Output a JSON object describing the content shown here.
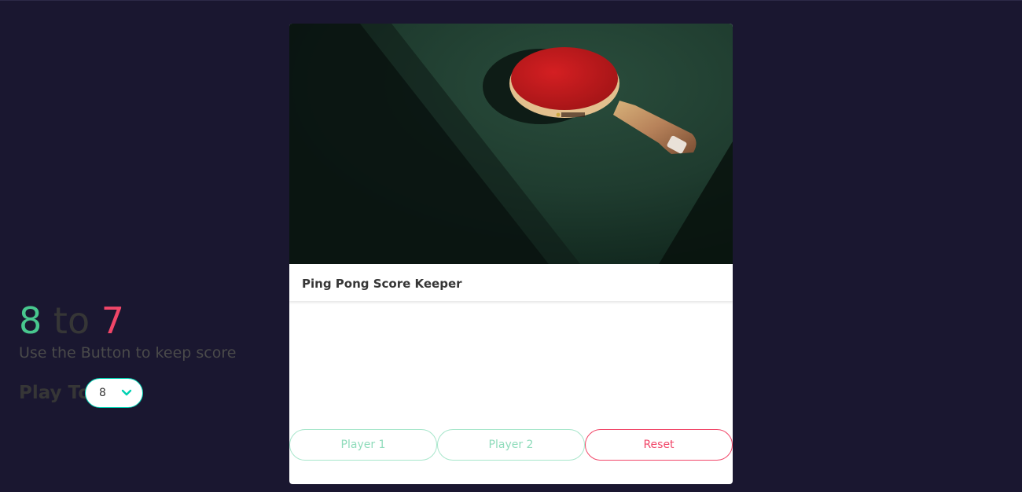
{
  "card": {
    "title": "Ping Pong Score Keeper"
  },
  "score": {
    "player1": "8",
    "separator": "to",
    "player2": "7"
  },
  "subtitle": "Use the Button to keep score",
  "play_to": {
    "label": "Play To",
    "selected": "8"
  },
  "buttons": {
    "player1": "Player 1",
    "player2": "Player 2",
    "reset": "Reset"
  },
  "colors": {
    "background": "#1a1730",
    "player1": "#48c78e",
    "player2": "#f14668",
    "accent": "#00d1b2"
  }
}
